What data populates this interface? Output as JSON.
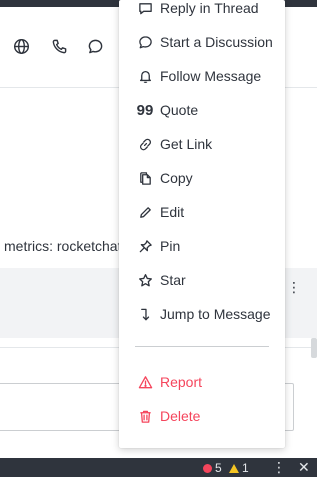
{
  "header": {
    "icons": [
      "globe-icon",
      "phone-icon",
      "discussion-icon"
    ]
  },
  "message": {
    "text_fragment": "metrics: rocketchat"
  },
  "menu": {
    "items": [
      {
        "label": "Reply in Thread",
        "icon": "thread-icon"
      },
      {
        "label": "Start a Discussion",
        "icon": "discussion-icon"
      },
      {
        "label": "Follow Message",
        "icon": "bell-icon"
      },
      {
        "label": "Quote",
        "icon": "quote-icon"
      },
      {
        "label": "Get Link",
        "icon": "link-icon"
      },
      {
        "label": "Copy",
        "icon": "copy-icon"
      },
      {
        "label": "Edit",
        "icon": "edit-icon"
      },
      {
        "label": "Pin",
        "icon": "pin-icon"
      },
      {
        "label": "Star",
        "icon": "star-icon"
      },
      {
        "label": "Jump to Message",
        "icon": "jump-icon"
      }
    ],
    "danger_items": [
      {
        "label": "Report",
        "icon": "warning-icon"
      },
      {
        "label": "Delete",
        "icon": "trash-icon"
      }
    ]
  },
  "statusbar": {
    "errors": "5",
    "warnings": "1"
  },
  "colors": {
    "danger": "#f5455c",
    "text": "#2f343d",
    "dark_bar": "#2f343d"
  }
}
